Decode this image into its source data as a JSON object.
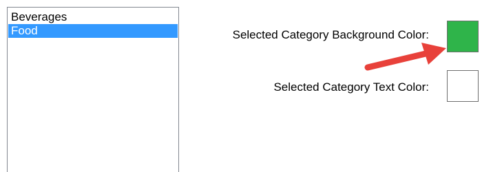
{
  "category_list": {
    "items": [
      {
        "label": "Beverages",
        "selected": false
      },
      {
        "label": "Food",
        "selected": true
      }
    ],
    "selection_color": "#3399ff"
  },
  "bg_color_setting": {
    "label": "Selected Category Background Color:",
    "value": "#2fb44a"
  },
  "text_color_setting": {
    "label": "Selected Category Text Color:",
    "value": "#ffffff"
  },
  "annotation": {
    "icon": "red-arrow-icon",
    "color": "#e8413a"
  }
}
